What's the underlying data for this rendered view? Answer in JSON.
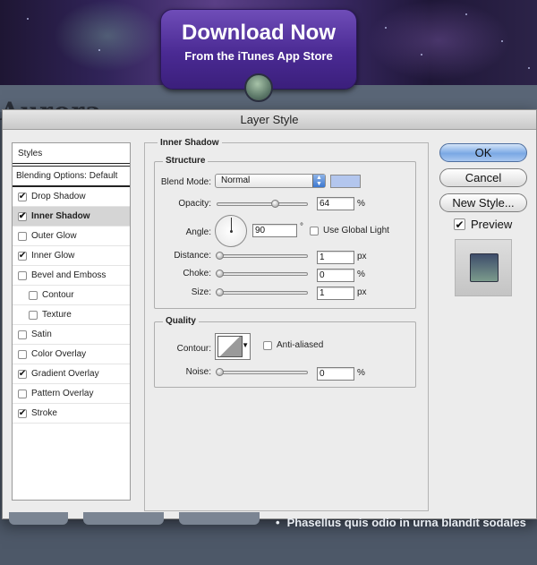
{
  "background": {
    "download_title": "Download Now",
    "download_subtitle": "From the iTunes App Store",
    "page_title_fragment": "Aurora",
    "bullet_text": "Phasellus quis odio in urna blandit sodales"
  },
  "dialog": {
    "title": "Layer Style",
    "styles_header": "Styles",
    "blending_options": "Blending Options: Default",
    "effects": [
      {
        "label": "Drop Shadow",
        "checked": true
      },
      {
        "label": "Inner Shadow",
        "checked": true,
        "selected": true
      },
      {
        "label": "Outer Glow",
        "checked": false
      },
      {
        "label": "Inner Glow",
        "checked": true
      },
      {
        "label": "Bevel and Emboss",
        "checked": false
      },
      {
        "label": "Contour",
        "checked": false,
        "sub": true
      },
      {
        "label": "Texture",
        "checked": false,
        "sub": true
      },
      {
        "label": "Satin",
        "checked": false
      },
      {
        "label": "Color Overlay",
        "checked": false
      },
      {
        "label": "Gradient Overlay",
        "checked": true
      },
      {
        "label": "Pattern Overlay",
        "checked": false
      },
      {
        "label": "Stroke",
        "checked": true
      }
    ],
    "panel_title": "Inner Shadow",
    "structure": {
      "label": "Structure",
      "blend_mode_label": "Blend Mode:",
      "blend_mode_value": "Normal",
      "color": "#b3c6ee",
      "opacity_label": "Opacity:",
      "opacity_value": "64",
      "opacity_unit": "%",
      "opacity_level": 0.64,
      "angle_label": "Angle:",
      "angle_value": "90",
      "angle_unit": "°",
      "use_global_light": "Use Global Light",
      "distance_label": "Distance:",
      "distance_value": "1",
      "distance_unit": "px",
      "choke_label": "Choke:",
      "choke_value": "0",
      "choke_unit": "%",
      "size_label": "Size:",
      "size_value": "1",
      "size_unit": "px"
    },
    "quality": {
      "label": "Quality",
      "contour_label": "Contour:",
      "anti_aliased": "Anti-aliased",
      "noise_label": "Noise:",
      "noise_value": "0",
      "noise_unit": "%"
    },
    "buttons": {
      "ok": "OK",
      "cancel": "Cancel",
      "new_style": "New Style...",
      "preview": "Preview"
    }
  }
}
